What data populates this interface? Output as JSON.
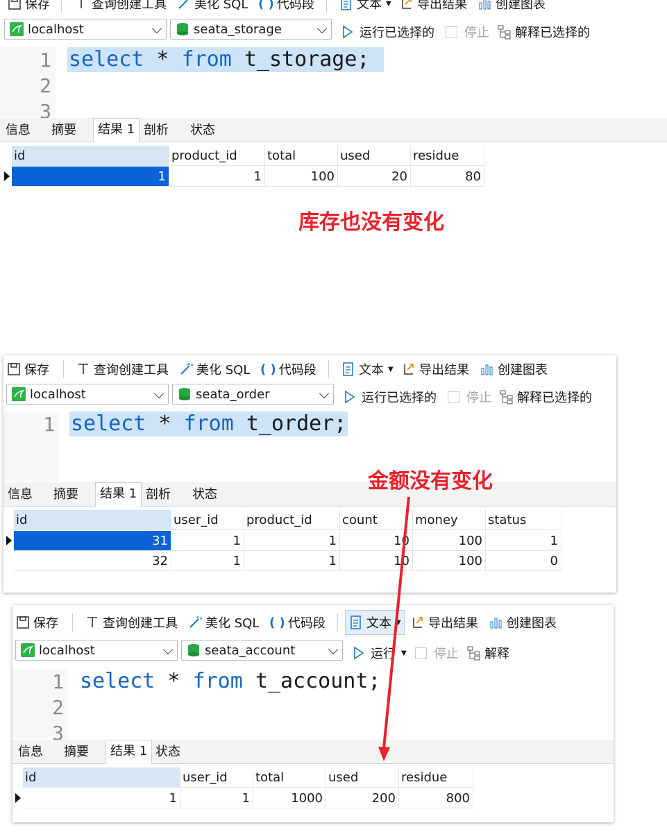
{
  "toolbar": {
    "save": "保存",
    "query_builder": "查询创建工具",
    "beautify_sql": "美化 SQL",
    "snippets": "代码段",
    "text": "文本",
    "export_result": "导出结果",
    "create_chart": "创建图表",
    "run_selected": "运行已选择的",
    "run_short": "运行",
    "stop": "停止",
    "explain_selected": "解释已选择的",
    "explain_short": "解释"
  },
  "result_tabs": [
    "信息",
    "摘要",
    "结果 1",
    "剖析",
    "状态"
  ],
  "result_tabs_account": [
    "信息",
    "摘要",
    "结果 1",
    "状态"
  ],
  "panels": [
    {
      "connection": "localhost",
      "database": "seata_storage",
      "lines": [
        "1",
        "2",
        "3"
      ],
      "sql": {
        "kw1": "select",
        "mid": " * ",
        "kw2": "from",
        "rest": " t_storage;"
      },
      "columns": [
        "id",
        "product_id",
        "total",
        "used",
        "residue"
      ],
      "rows": [
        [
          "1",
          "1",
          "100",
          "20",
          "80"
        ]
      ]
    },
    {
      "connection": "localhost",
      "database": "seata_order",
      "lines": [
        "1"
      ],
      "sql": {
        "kw1": "select",
        "mid": " * ",
        "kw2": "from",
        "rest": " t_order;"
      },
      "columns": [
        "id",
        "user_id",
        "product_id",
        "count",
        "money",
        "status"
      ],
      "rows": [
        [
          "31",
          "1",
          "1",
          "10",
          "100",
          "1"
        ],
        [
          "32",
          "1",
          "1",
          "10",
          "100",
          "0"
        ]
      ]
    },
    {
      "connection": "localhost",
      "database": "seata_account",
      "lines": [
        "1",
        "2",
        "3"
      ],
      "sql": {
        "kw1": "select",
        "mid": " * ",
        "kw2": "from",
        "rest": " t_account;"
      },
      "columns": [
        "id",
        "user_id",
        "total",
        "used",
        "residue"
      ],
      "rows": [
        [
          "1",
          "1",
          "1000",
          "200",
          "800"
        ]
      ]
    }
  ],
  "annotations": {
    "storage_note": "库存也没有变化",
    "money_note": "金额没有变化",
    "color": "#e8222b"
  },
  "colors": {
    "accent": "#0a64d8",
    "highlight": "#cde3f7",
    "keyword": "#1565c0"
  }
}
